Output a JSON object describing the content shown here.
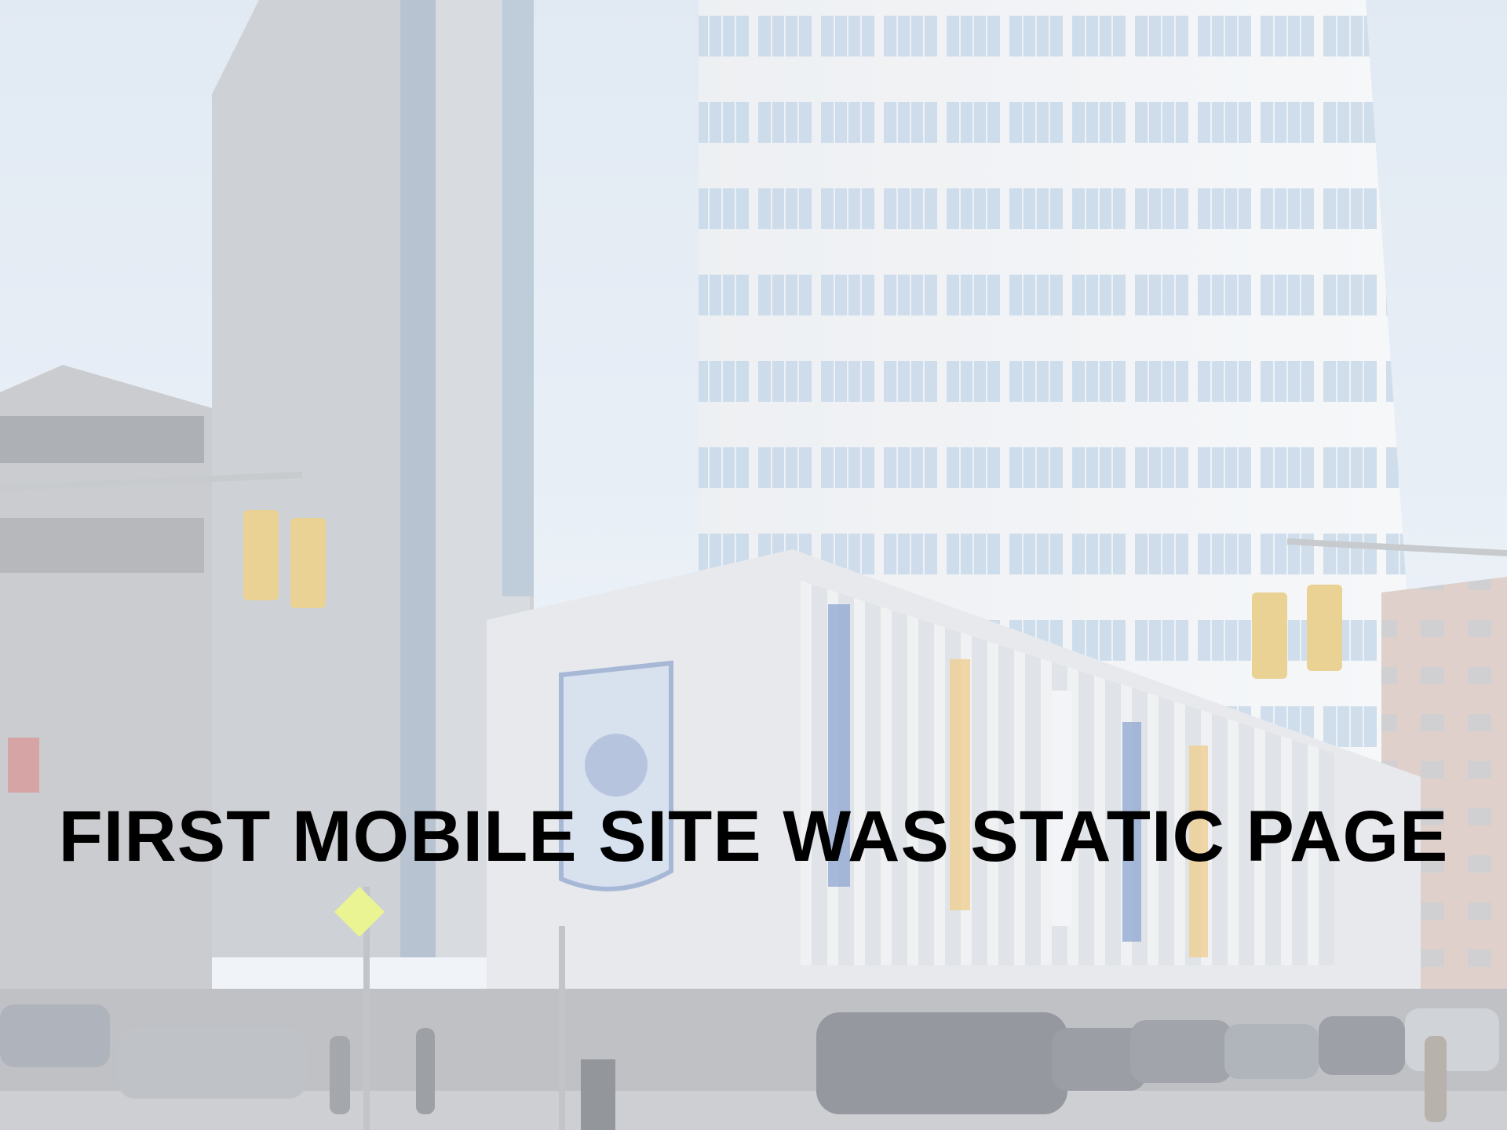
{
  "slide": {
    "title": "FIRST MOBILE SITE WAS STATIC PAGE",
    "title_color": "#000000"
  },
  "photo": {
    "subject": "building-photo"
  }
}
